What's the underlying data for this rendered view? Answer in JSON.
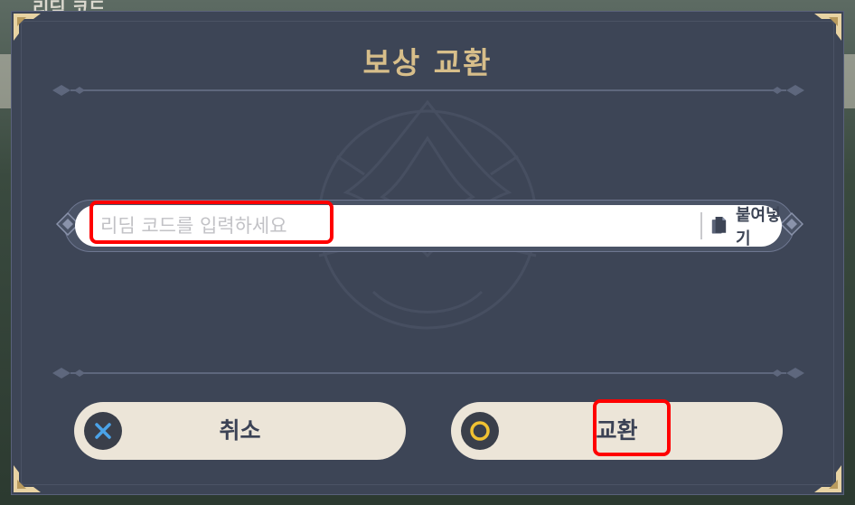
{
  "background": {
    "peek_text": "리딤 코드"
  },
  "dialog": {
    "title": "보상 교환",
    "code_input": {
      "value": "",
      "placeholder": "리딤 코드를 입력하세요"
    },
    "paste_button": {
      "label": "붙여넣기",
      "icon": "clipboard-icon"
    },
    "cancel_button": {
      "label": "취소",
      "icon": "x-circle-icon",
      "icon_color": "#4aa3e8"
    },
    "confirm_button": {
      "label": "교환",
      "icon": "o-circle-icon",
      "icon_color": "#f1c232"
    }
  },
  "colors": {
    "dialog_bg": "#3d4556",
    "title_gold": "#d7be8a",
    "button_bg": "#ece5d8",
    "highlight": "#ff0000"
  }
}
